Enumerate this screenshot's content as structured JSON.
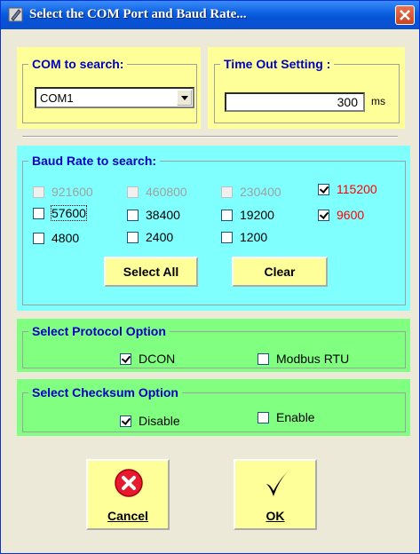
{
  "window": {
    "title": "Select the COM Port and Baud Rate...",
    "icons": {
      "title_icon": "pen-icon",
      "close_icon": "close-icon"
    }
  },
  "com_search": {
    "legend": "COM to search:",
    "selected": "COM1"
  },
  "timeout": {
    "legend": "Time Out Setting :",
    "value": "300",
    "unit": "ms"
  },
  "baud": {
    "legend": "Baud Rate to search:",
    "options": [
      {
        "label": "921600",
        "checked": false,
        "enabled": false,
        "color": "gray"
      },
      {
        "label": "460800",
        "checked": false,
        "enabled": false,
        "color": "gray"
      },
      {
        "label": "230400",
        "checked": false,
        "enabled": false,
        "color": "gray"
      },
      {
        "label": "115200",
        "checked": true,
        "enabled": true,
        "color": "red"
      },
      {
        "label": "57600",
        "checked": false,
        "enabled": true,
        "color": "black"
      },
      {
        "label": "38400",
        "checked": false,
        "enabled": true,
        "color": "black"
      },
      {
        "label": "19200",
        "checked": false,
        "enabled": true,
        "color": "black"
      },
      {
        "label": "9600",
        "checked": true,
        "enabled": true,
        "color": "red"
      },
      {
        "label": "4800",
        "checked": false,
        "enabled": true,
        "color": "black"
      },
      {
        "label": "2400",
        "checked": false,
        "enabled": true,
        "color": "black"
      },
      {
        "label": "1200",
        "checked": false,
        "enabled": true,
        "color": "black"
      }
    ],
    "select_all_label": "Select All",
    "clear_label": "Clear"
  },
  "protocol": {
    "legend": "Select Protocol Option",
    "dcon": {
      "label": "DCON",
      "checked": true
    },
    "modbus": {
      "label": "Modbus RTU",
      "checked": false
    }
  },
  "checksum": {
    "legend": "Select Checksum  Option",
    "disable": {
      "label": "Disable",
      "checked": true
    },
    "enable": {
      "label": "Enable",
      "checked": false
    }
  },
  "actions": {
    "cancel_label": "Cancel",
    "ok_label": "OK",
    "cancel_icon": "cancel-x-icon",
    "ok_icon": "checkmark-icon"
  },
  "colors": {
    "yellow_panel": "#ffff99",
    "cyan_panel": "#80ffff",
    "green_panel": "#80ff80",
    "legend_text": "#0000c0",
    "checked_baud_text": "#ff0000"
  }
}
